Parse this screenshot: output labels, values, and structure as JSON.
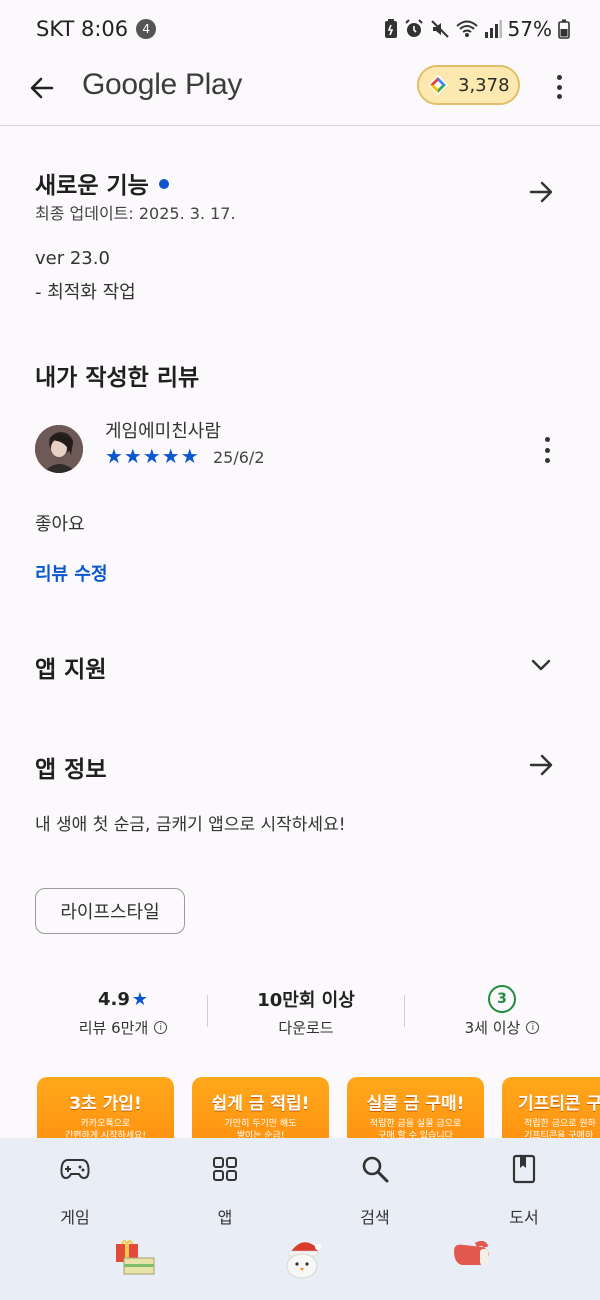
{
  "status_bar": {
    "carrier_time": "SKT 8:06",
    "notification_count": "4",
    "battery": "57%"
  },
  "app_bar": {
    "title": "Google Play",
    "points": "3,378"
  },
  "whats_new": {
    "title": "새로운 기능",
    "updated": "최종 업데이트: 2025. 3. 17.",
    "version": "ver 23.0",
    "note": "- 최적화 작업"
  },
  "my_review": {
    "title": "내가 작성한 리뷰",
    "reviewer": "게임에미친사람",
    "stars": "★★★★★",
    "rating": 5,
    "date": "25/6/2",
    "text": "좋아요",
    "edit_link": "리뷰 수정"
  },
  "app_support": {
    "title": "앱 지원"
  },
  "app_info": {
    "title": "앱 정보",
    "description": "내 생애 첫 순금, 금캐기 앱으로 시작하세요!",
    "category_chip": "라이프스타일"
  },
  "stats": [
    {
      "value": "4.9",
      "label": "리뷰 6만개"
    },
    {
      "value": "10만회 이상",
      "label": "다운로드"
    },
    {
      "value": "3",
      "label": "3세 이상"
    }
  ],
  "screenshots": [
    {
      "title": "3초 가입!",
      "sub1": "카카오톡으로",
      "sub2": "간편하게 시작하세요!"
    },
    {
      "title": "쉽게 금 적립!",
      "sub1": "가만히 두기만 해도",
      "sub2": "쌓이는 순금!"
    },
    {
      "title": "실물 금 구매!",
      "sub1": "적립한 금을 실물 금으로",
      "sub2": "구매 할 수 있습니다"
    },
    {
      "title": "기프티콘 구",
      "sub1": "적립한 금으로 원하",
      "sub2": "기프티콘을 구매하"
    }
  ],
  "bottom_nav": [
    {
      "label": "게임",
      "icon": "gamepad-icon"
    },
    {
      "label": "앱",
      "icon": "apps-grid-icon"
    },
    {
      "label": "검색",
      "icon": "search-icon"
    },
    {
      "label": "도서",
      "icon": "book-icon"
    }
  ],
  "colors": {
    "accent_blue": "#0b57d0",
    "age_green": "#1e8e3e",
    "nav_bg": "#e9eef6",
    "points_bg": "#fde9b0"
  }
}
